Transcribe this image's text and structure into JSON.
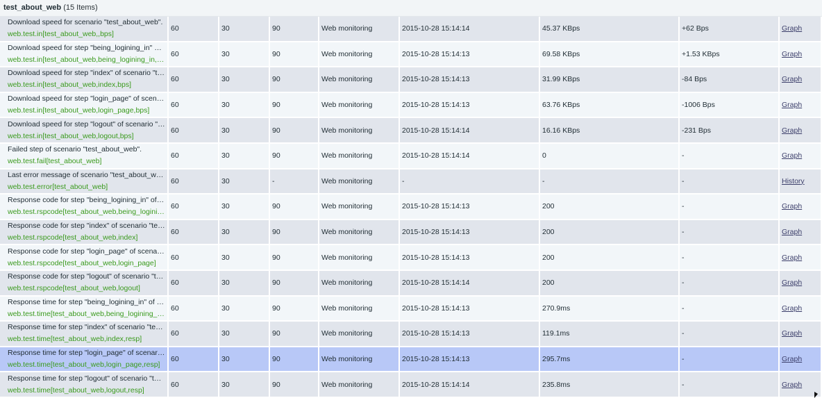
{
  "group": {
    "name": "test_about_web",
    "count_label": "(15 Items)"
  },
  "rows": [
    {
      "desc": "Download speed for scenario \"test_about_web\".",
      "key": "web.test.in[test_about_web,,bps]",
      "interval": "60",
      "history": "30",
      "trends": "90",
      "type": "Web monitoring",
      "last_check": "2015-10-28 15:14:14",
      "last_value": "45.37 KBps",
      "change": "+62 Bps",
      "action": "Graph"
    },
    {
      "desc": "Download speed for step \"being_logining_in\" of s...",
      "key": "web.test.in[test_about_web,being_logining_in,bps]",
      "interval": "60",
      "history": "30",
      "trends": "90",
      "type": "Web monitoring",
      "last_check": "2015-10-28 15:14:13",
      "last_value": "69.58 KBps",
      "change": "+1.53 KBps",
      "action": "Graph"
    },
    {
      "desc": "Download speed for step \"index\" of scenario \"tes...",
      "key": "web.test.in[test_about_web,index,bps]",
      "interval": "60",
      "history": "30",
      "trends": "90",
      "type": "Web monitoring",
      "last_check": "2015-10-28 15:14:13",
      "last_value": "31.99 KBps",
      "change": "-84 Bps",
      "action": "Graph"
    },
    {
      "desc": "Download speed for step \"login_page\" of scenari...",
      "key": "web.test.in[test_about_web,login_page,bps]",
      "interval": "60",
      "history": "30",
      "trends": "90",
      "type": "Web monitoring",
      "last_check": "2015-10-28 15:14:13",
      "last_value": "63.76 KBps",
      "change": "-1006 Bps",
      "action": "Graph"
    },
    {
      "desc": "Download speed for step \"logout\" of scenario \"te...",
      "key": "web.test.in[test_about_web,logout,bps]",
      "interval": "60",
      "history": "30",
      "trends": "90",
      "type": "Web monitoring",
      "last_check": "2015-10-28 15:14:14",
      "last_value": "16.16 KBps",
      "change": "-231 Bps",
      "action": "Graph"
    },
    {
      "desc": "Failed step of scenario \"test_about_web\".",
      "key": "web.test.fail[test_about_web]",
      "interval": "60",
      "history": "30",
      "trends": "90",
      "type": "Web monitoring",
      "last_check": "2015-10-28 15:14:14",
      "last_value": "0",
      "change": "-",
      "action": "Graph"
    },
    {
      "desc": "Last error message of scenario \"test_about_web\".",
      "key": "web.test.error[test_about_web]",
      "interval": "60",
      "history": "30",
      "trends": "-",
      "type": "Web monitoring",
      "last_check": "-",
      "last_value": "-",
      "change": "-",
      "action": "History"
    },
    {
      "desc": "Response code for step \"being_logining_in\" of sc...",
      "key": "web.test.rspcode[test_about_web,being_logining...",
      "interval": "60",
      "history": "30",
      "trends": "90",
      "type": "Web monitoring",
      "last_check": "2015-10-28 15:14:13",
      "last_value": "200",
      "change": "-",
      "action": "Graph"
    },
    {
      "desc": "Response code for step \"index\" of scenario \"test...",
      "key": "web.test.rspcode[test_about_web,index]",
      "interval": "60",
      "history": "30",
      "trends": "90",
      "type": "Web monitoring",
      "last_check": "2015-10-28 15:14:13",
      "last_value": "200",
      "change": "-",
      "action": "Graph"
    },
    {
      "desc": "Response code for step \"login_page\" of scenario ...",
      "key": "web.test.rspcode[test_about_web,login_page]",
      "interval": "60",
      "history": "30",
      "trends": "90",
      "type": "Web monitoring",
      "last_check": "2015-10-28 15:14:13",
      "last_value": "200",
      "change": "-",
      "action": "Graph"
    },
    {
      "desc": "Response code for step \"logout\" of scenario \"test...",
      "key": "web.test.rspcode[test_about_web,logout]",
      "interval": "60",
      "history": "30",
      "trends": "90",
      "type": "Web monitoring",
      "last_check": "2015-10-28 15:14:14",
      "last_value": "200",
      "change": "-",
      "action": "Graph"
    },
    {
      "desc": "Response time for step \"being_logining_in\" of sc...",
      "key": "web.test.time[test_about_web,being_logining_in,r...",
      "interval": "60",
      "history": "30",
      "trends": "90",
      "type": "Web monitoring",
      "last_check": "2015-10-28 15:14:13",
      "last_value": "270.9ms",
      "change": "-",
      "action": "Graph"
    },
    {
      "desc": "Response time for step \"index\" of scenario \"test_...",
      "key": "web.test.time[test_about_web,index,resp]",
      "interval": "60",
      "history": "30",
      "trends": "90",
      "type": "Web monitoring",
      "last_check": "2015-10-28 15:14:13",
      "last_value": "119.1ms",
      "change": "-",
      "action": "Graph"
    },
    {
      "desc": "Response time for step \"login_page\" of scenario ...",
      "key": "web.test.time[test_about_web,login_page,resp]",
      "interval": "60",
      "history": "30",
      "trends": "90",
      "type": "Web monitoring",
      "last_check": "2015-10-28 15:14:13",
      "last_value": "295.7ms",
      "change": "-",
      "action": "Graph",
      "selected": true
    },
    {
      "desc": "Response time for step \"logout\" of scenario \"test...",
      "key": "web.test.time[test_about_web,logout,resp]",
      "interval": "60",
      "history": "30",
      "trends": "90",
      "type": "Web monitoring",
      "last_check": "2015-10-28 15:14:14",
      "last_value": "235.8ms",
      "change": "-",
      "action": "Graph"
    }
  ],
  "colors": {
    "row_odd": "#e1e5ec",
    "row_even": "#f2f6f9",
    "row_selected": "#b8c8f7",
    "item_key": "#3a9a1d",
    "link": "#3b3e6a"
  }
}
